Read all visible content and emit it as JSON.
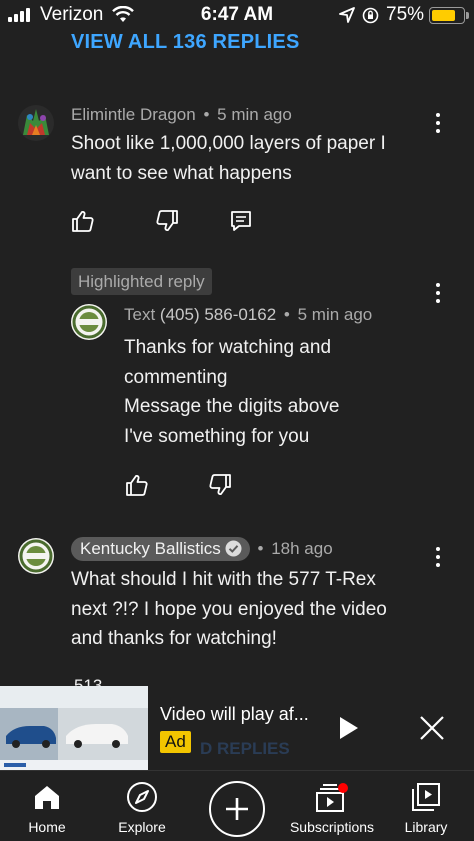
{
  "status_bar": {
    "carrier": "Verizon",
    "time": "6:47 AM",
    "battery_pct": "75%",
    "battery_level": 0.75
  },
  "thread": {
    "view_all_replies": "VIEW ALL 136 REPLIES"
  },
  "comments": [
    {
      "author": "Elimintle Dragon",
      "separator": "•",
      "time": "5 min ago",
      "text_lines": [
        "Shoot like 1,000,000 layers of paper I",
        "want to see what happens"
      ]
    },
    {
      "highlight_label": "Highlighted reply",
      "author": "Text",
      "phone": "(405) 586-0162",
      "separator": "•",
      "time": "5 min ago",
      "text_lines": [
        "Thanks for watching and",
        "commenting",
        "Message the digits above",
        "I've something for you"
      ]
    },
    {
      "author": "Kentucky Ballistics",
      "separator": "•",
      "time": "18h ago",
      "text_lines": [
        "What should I hit with the 577 T-Rex",
        "next ?!? I hope you enjoyed the video",
        "and thanks for watching!"
      ],
      "like_count_partial": "513"
    }
  ],
  "ad": {
    "title": "Video will play af...",
    "badge": "Ad",
    "ghost_text": "D REPLIES"
  },
  "bottom_nav": {
    "items": [
      {
        "label": "Home",
        "icon": "home-icon"
      },
      {
        "label": "Explore",
        "icon": "compass-icon"
      },
      {
        "label": "",
        "icon": "plus-icon"
      },
      {
        "label": "Subscriptions",
        "icon": "subscriptions-icon"
      },
      {
        "label": "Library",
        "icon": "library-icon"
      }
    ]
  },
  "colors": {
    "background": "#212121",
    "link_blue": "#3ea6ff",
    "ad_yellow": "#f3c500",
    "battery_yellow": "#ffcc00",
    "notification_red": "#ff0000"
  }
}
